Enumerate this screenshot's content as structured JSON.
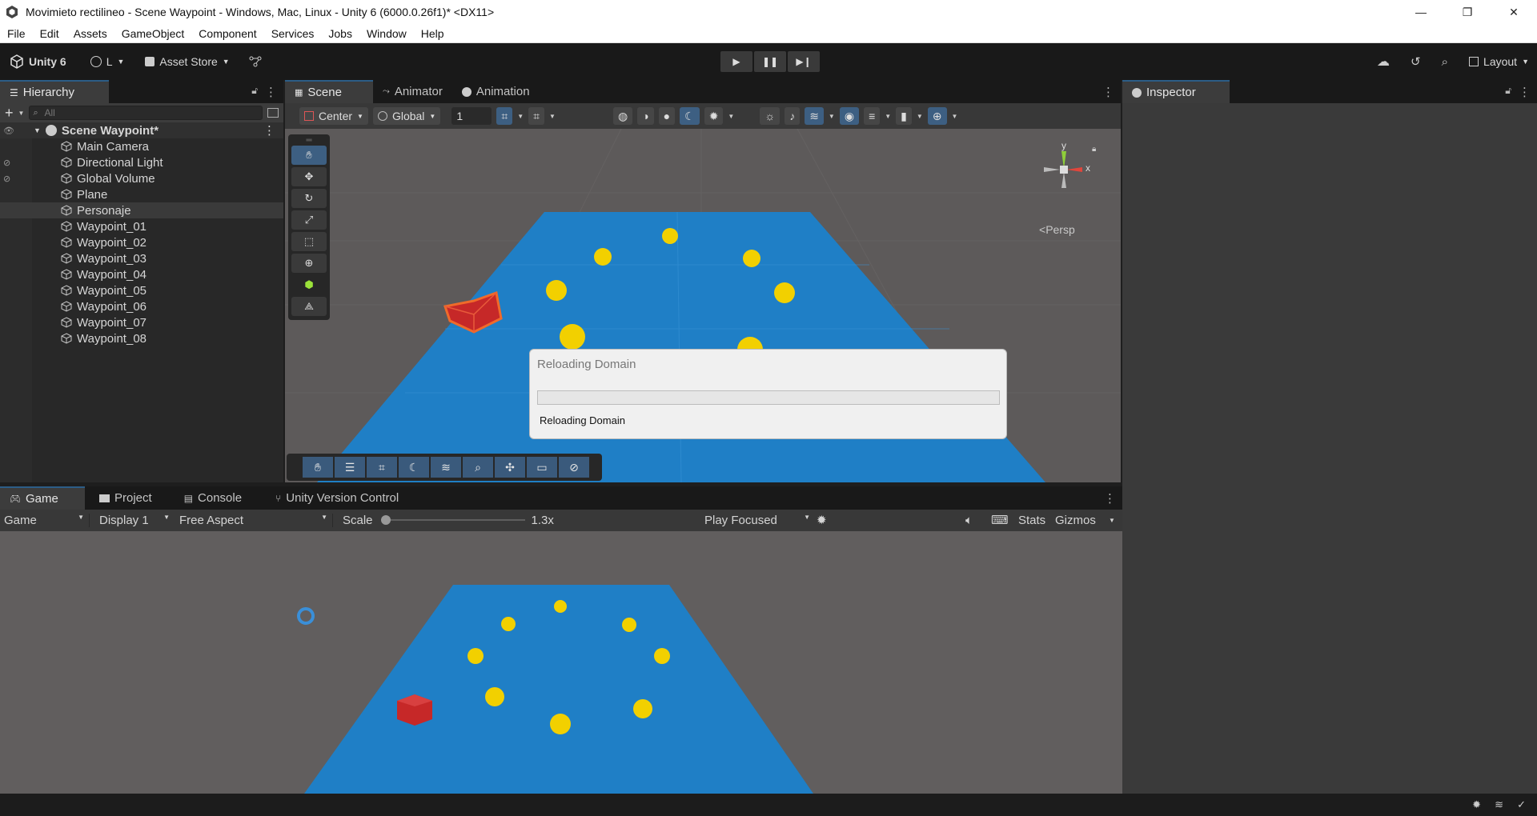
{
  "window": {
    "title": "Movimieto rectilineo - Scene Waypoint - Windows, Mac, Linux - Unity 6 (6000.0.26f1)* <DX11>",
    "minimize": "—",
    "maximize": "❐",
    "close": "✕"
  },
  "menu": [
    "File",
    "Edit",
    "Assets",
    "GameObject",
    "Component",
    "Services",
    "Jobs",
    "Window",
    "Help"
  ],
  "toolbar": {
    "unity_label": "Unity 6",
    "account_label": "L",
    "asset_store_label": "Asset Store",
    "layout_label": "Layout"
  },
  "hierarchy": {
    "tab": "Hierarchy",
    "search_placeholder": "All",
    "scene_name": "Scene Waypoint*",
    "items": [
      "Main Camera",
      "Directional Light",
      "Global Volume",
      "Plane",
      "Personaje",
      "Waypoint_01",
      "Waypoint_02",
      "Waypoint_03",
      "Waypoint_04",
      "Waypoint_05",
      "Waypoint_06",
      "Waypoint_07",
      "Waypoint_08"
    ],
    "selected_item": "Personaje"
  },
  "scene_tabs": [
    "Scene",
    "Animator",
    "Animation"
  ],
  "scene_toolbar": {
    "pivot": "Center",
    "space": "Global",
    "snap_value": "1",
    "persp_label": "Persp",
    "gizmo_y": "y",
    "gizmo_x": "x"
  },
  "dialog": {
    "title": "Reloading Domain",
    "message": "Reloading Domain",
    "progress": 0
  },
  "bottom_tabs": [
    "Game",
    "Project",
    "Console",
    "Unity Version Control"
  ],
  "game_toolbar": {
    "mode": "Game",
    "display": "Display 1",
    "aspect": "Free Aspect",
    "scale_label": "Scale",
    "scale_value": "1.3x",
    "play_mode": "Play Focused",
    "stats": "Stats",
    "gizmos": "Gizmos"
  },
  "inspector": {
    "tab": "Inspector"
  },
  "colors": {
    "plane": "#1f7fc6",
    "sphere": "#f2d000",
    "cube": "#d32f2f",
    "accent": "#2c5d87"
  }
}
